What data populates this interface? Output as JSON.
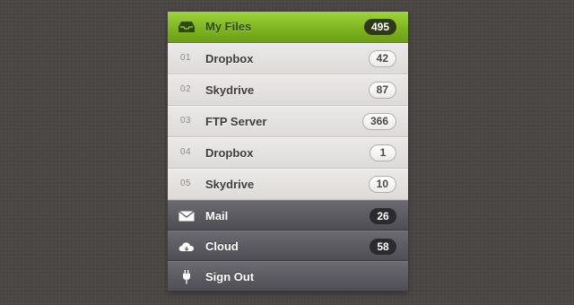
{
  "menu": {
    "header": {
      "label": "My Files",
      "count": "495",
      "icon": "inbox-icon"
    },
    "items": [
      {
        "num": "01",
        "label": "Dropbox",
        "count": "42"
      },
      {
        "num": "02",
        "label": "Skydrive",
        "count": "87"
      },
      {
        "num": "03",
        "label": "FTP Server",
        "count": "366"
      },
      {
        "num": "04",
        "label": "Dropbox",
        "count": "1"
      },
      {
        "num": "05",
        "label": "Skydrive",
        "count": "10"
      }
    ],
    "mail": {
      "label": "Mail",
      "count": "26",
      "icon": "envelope-icon"
    },
    "cloud": {
      "label": "Cloud",
      "count": "58",
      "icon": "cloud-icon"
    },
    "signout": {
      "label": "Sign Out",
      "icon": "plug-icon"
    }
  },
  "colors": {
    "background": "#4a4643",
    "accent": "#8cc42a",
    "item_light": "#e4e2df",
    "item_dark": "#5c5b61"
  }
}
